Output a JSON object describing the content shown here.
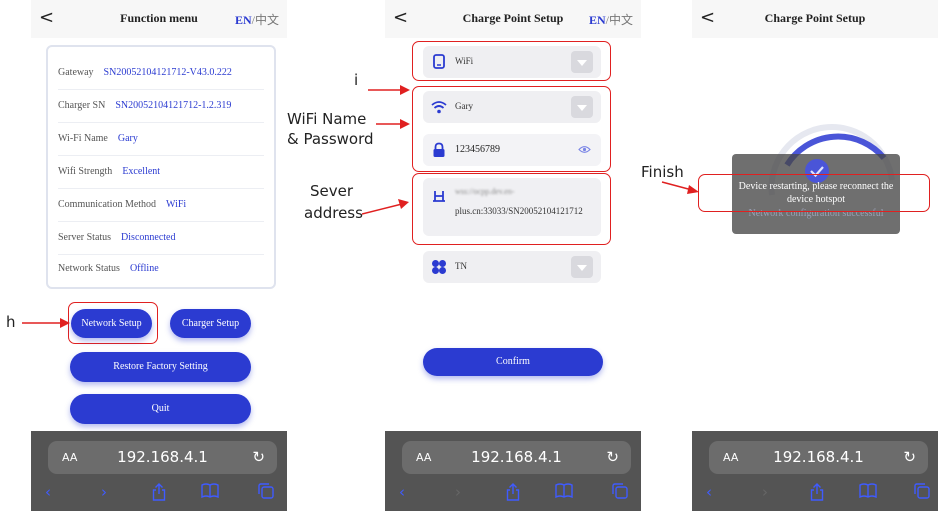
{
  "panel1": {
    "back": "<",
    "title": "Function menu",
    "lang_en": "EN",
    "lang_sep": "/",
    "lang_zh": "中文",
    "rows": [
      {
        "label": "Gateway",
        "value": "SN20052104121712-V43.0.222"
      },
      {
        "label": "Charger SN",
        "value": "SN20052104121712-1.2.319"
      },
      {
        "label": "Wi-Fi Name",
        "value": "Gary"
      },
      {
        "label": "Wifi Strength",
        "value": "Excellent"
      },
      {
        "label": "Communication Method",
        "value": "WiFi"
      },
      {
        "label": "Server Status",
        "value": "Disconnected"
      },
      {
        "label": "Network Status",
        "value": "Offline"
      }
    ],
    "network_setup": "Network Setup",
    "charger_setup": "Charger Setup",
    "restore": "Restore Factory Setting",
    "quit": "Quit",
    "annotation_h": "h"
  },
  "panel2": {
    "back": "<",
    "title": "Charge Point Setup",
    "lang_en": "EN",
    "lang_sep": "/",
    "lang_zh": "中文",
    "mode": "WiFi",
    "wifi_name": "Gary",
    "wifi_password": "123456789",
    "server_line1": "wss://ocpp.dev.en-",
    "server_line2": "plus.cn:33033/SN20052104121712",
    "network_type": "TN",
    "confirm": "Confirm",
    "annotation_i": "i",
    "annotation_wifi": "WiFi Name\n& Password",
    "annotation_wifi_1": "WiFi Name",
    "annotation_wifi_2": "& Password",
    "annotation_server_1": "Sever",
    "annotation_server_2": "address"
  },
  "panel3": {
    "back": "<",
    "title": "Charge Point Setup",
    "toast_message": "Device restarting, please reconnect the device hotspot",
    "toast_sub": "Network configuration successful",
    "annotation_finish": "Finish"
  },
  "browser": {
    "aa": "AA",
    "url": "192.168.4.1",
    "reload": "↻"
  },
  "colors": {
    "accent": "#2b3bd1",
    "annotation_red": "#e02020",
    "browser_bg": "#545454",
    "ios_blue": "#3f5bff"
  }
}
